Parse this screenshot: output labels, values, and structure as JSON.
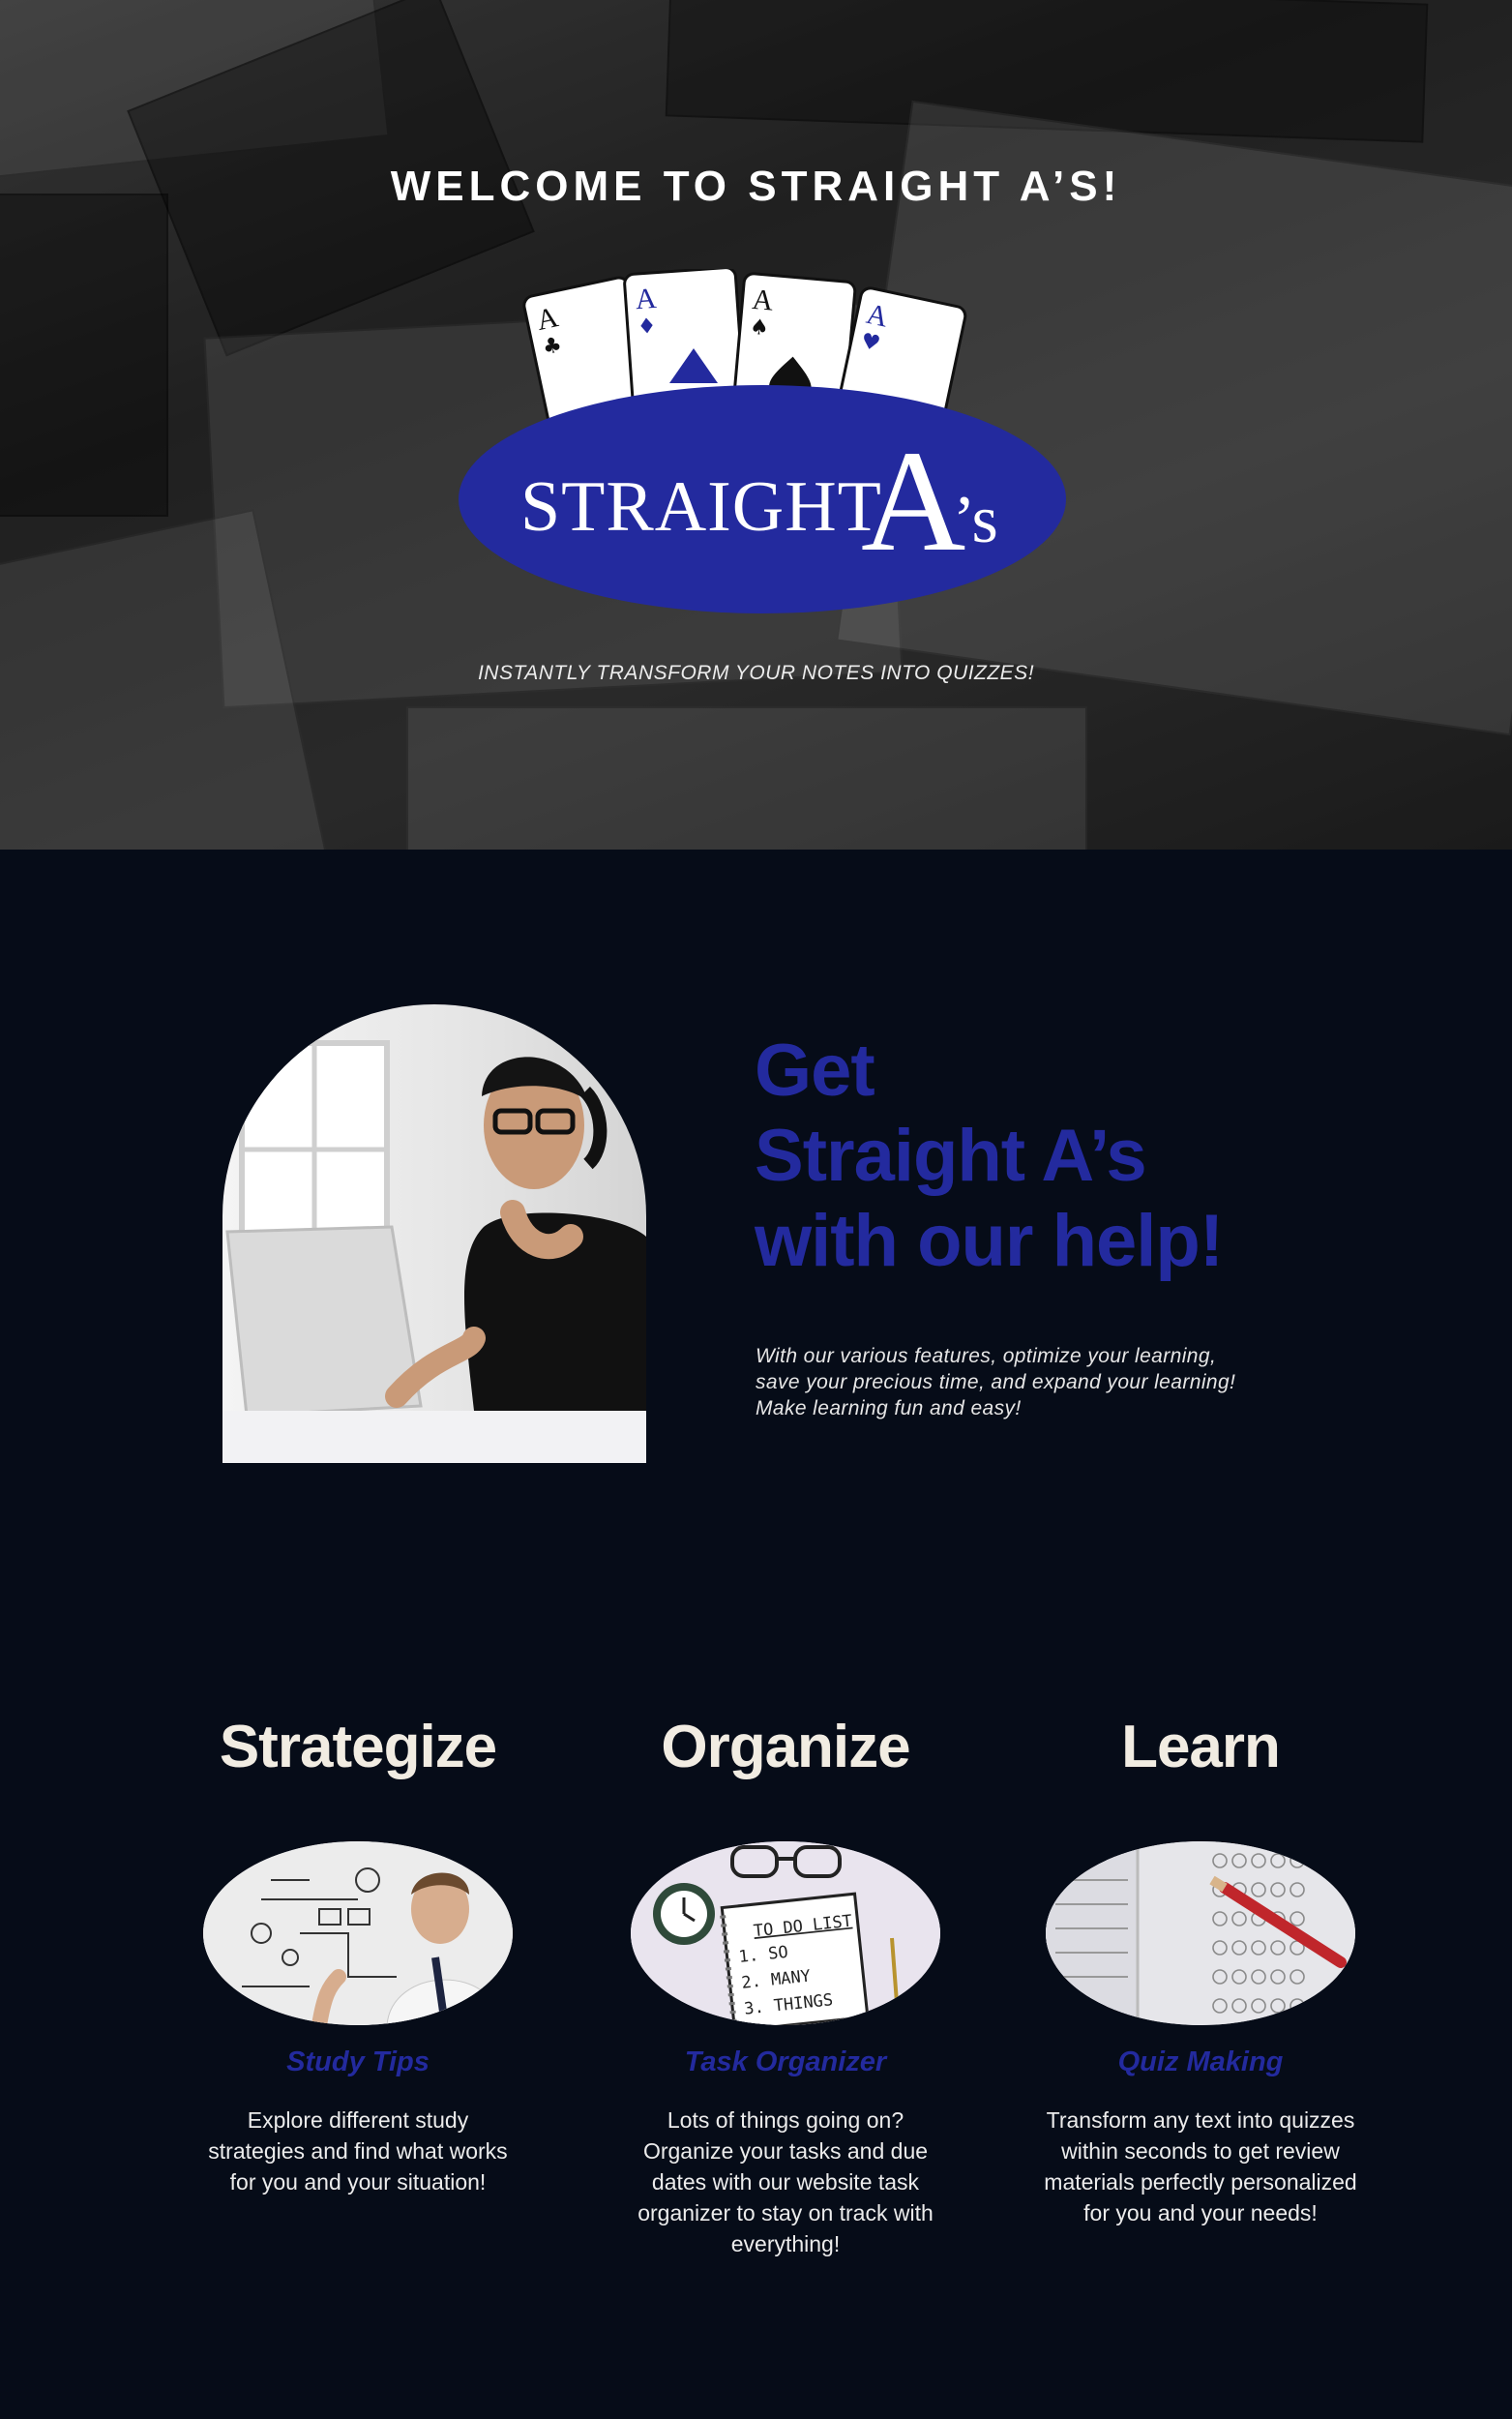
{
  "hero": {
    "welcome": "WELCOME TO STRAIGHT A’S!",
    "logo": {
      "wordmark": "STRAIGHT",
      "big_letter": "A",
      "suffix": "’s",
      "card_rank": "A",
      "card_suits": [
        "♣",
        "♦",
        "♠",
        "♥"
      ]
    },
    "tagline": "INSTANTLY TRANSFORM YOUR  NOTES INTO QUIZZES!"
  },
  "help": {
    "headline": [
      "Get",
      "Straight A’s",
      "with our help!"
    ],
    "intro": [
      "With our various features, optimize your learning,",
      "save your precious time, and expand your learning!",
      "Make learning fun and easy!"
    ]
  },
  "features": [
    {
      "title": "Strategize",
      "subtitle": "Study Tips",
      "description": "Explore different study strategies and find what works for you and your situation!"
    },
    {
      "title": "Organize",
      "subtitle": "Task Organizer",
      "description": "Lots of things going on? Organize your tasks and due dates with our website task organizer to stay on track with everything!",
      "image_text": [
        "TO DO LIST",
        "1. SO",
        "2. MANY",
        "3. THINGS"
      ]
    },
    {
      "title": "Learn",
      "subtitle": "Quiz Making",
      "description": "Transform any text into quizzes within seconds to get review materials perfectly personalized for you and your needs!"
    }
  ],
  "colors": {
    "background": "#060c18",
    "brand_blue": "#232a9e",
    "cream": "#f1ece2"
  }
}
